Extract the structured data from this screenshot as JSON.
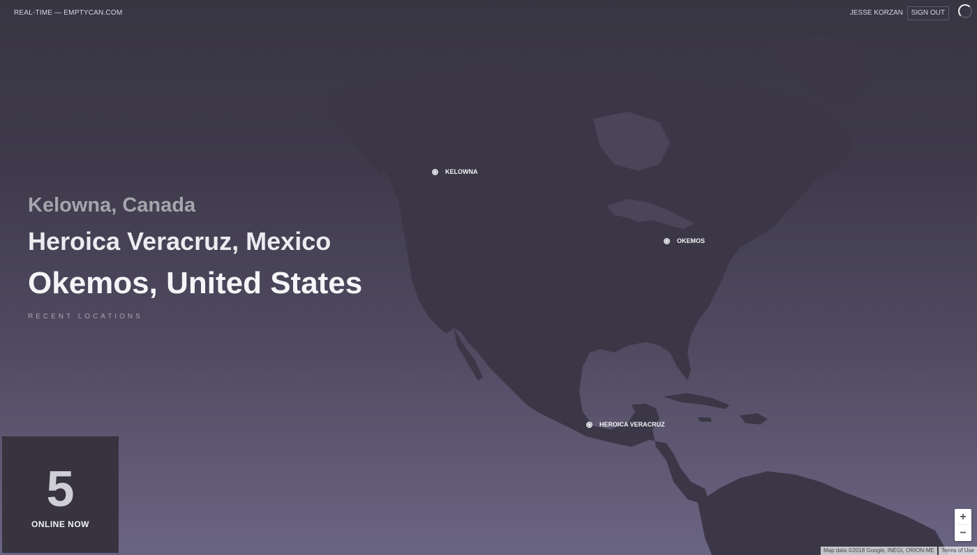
{
  "header": {
    "brand": "REAL-TIME — EMPTYCAN.COM",
    "user_name": "JESSE KORZAN",
    "sign_out_label": "SIGN OUT"
  },
  "recent_locations": {
    "items": [
      "Kelowna, Canada",
      "Heroica Veracruz, Mexico",
      "Okemos, United States"
    ],
    "label": "RECENT LOCATIONS"
  },
  "map": {
    "markers": [
      {
        "label": "KELOWNA"
      },
      {
        "label": "OKEMOS"
      },
      {
        "label": "HEROICA VERACRUZ"
      }
    ],
    "zoom_in_label": "+",
    "zoom_out_label": "−",
    "attribution": "Map data ©2018 Google, INEGI, ORION-ME",
    "terms_label": "Terms of Use"
  },
  "online": {
    "count": "5",
    "label": "ONLINE NOW"
  },
  "colors": {
    "background_top": "#383543",
    "background_bottom": "#6b6584",
    "land": "#3b3747",
    "panel": "#38343f"
  }
}
